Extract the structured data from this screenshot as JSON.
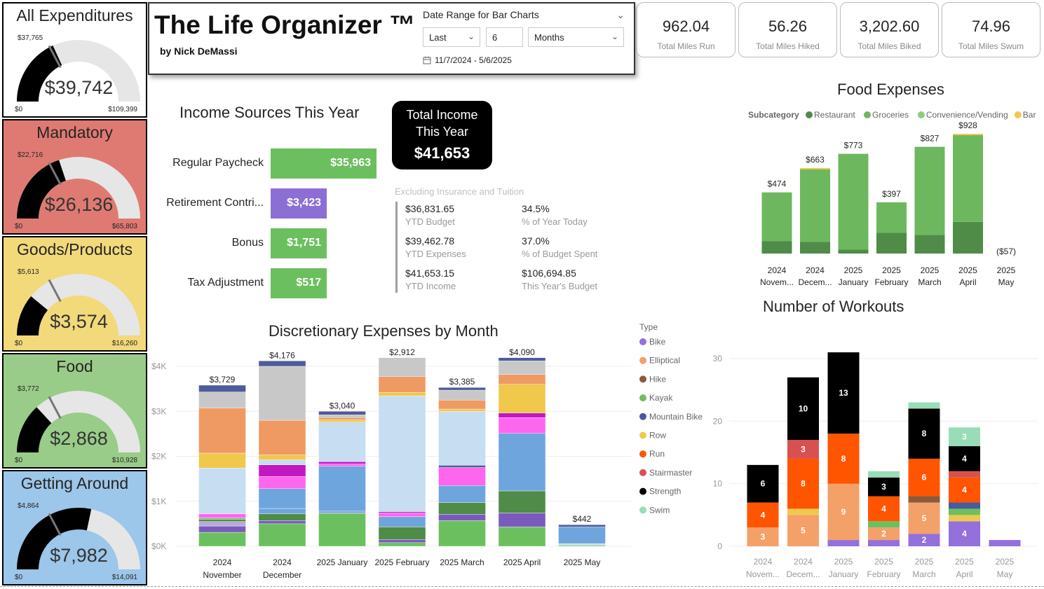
{
  "gauges": [
    {
      "title": "All Expenditures",
      "value": "$39,742",
      "target": "$37,765",
      "min": "$0",
      "max": "$109,399",
      "bg": "#ffffff",
      "value_num": 39742,
      "target_num": 37765,
      "max_num": 109399
    },
    {
      "title": "Mandatory",
      "value": "$26,136",
      "target": "$22,716",
      "min": "$0",
      "max": "$65,803",
      "bg": "#df7a73",
      "value_num": 26136,
      "target_num": 22716,
      "max_num": 65803
    },
    {
      "title": "Goods/Products",
      "value": "$3,574",
      "target": "$5,613",
      "min": "$0",
      "max": "$16,260",
      "bg": "#f2d97a",
      "value_num": 3574,
      "target_num": 5613,
      "max_num": 16260
    },
    {
      "title": "Food",
      "value": "$2,868",
      "target": "$3,772",
      "min": "$0",
      "max": "$10,928",
      "bg": "#99cc88",
      "value_num": 2868,
      "target_num": 3772,
      "max_num": 10928
    },
    {
      "title": "Getting Around",
      "value": "$7,982",
      "target": "$4,864",
      "min": "$0",
      "max": "$14,091",
      "bg": "#9cc6ea",
      "value_num": 7982,
      "target_num": 4864,
      "max_num": 14091
    }
  ],
  "header": {
    "title": "The Life Organizer ™",
    "subtitle": "by Nick DeMassi",
    "date_label": "Date Range for Bar Charts",
    "relative": "Last",
    "count": "6",
    "unit": "Months",
    "range": "11/7/2024 - 5/6/2025"
  },
  "kpis": [
    {
      "value": "962.04",
      "label": "Total Miles Run"
    },
    {
      "value": "56.26",
      "label": "Total Miles Hiked"
    },
    {
      "value": "3,202.60",
      "label": "Total Miles Biked"
    },
    {
      "value": "74.96",
      "label": "Total Miles Swum"
    }
  ],
  "income": {
    "title": "Income Sources This Year",
    "bars": [
      {
        "label": "Regular Paycheck",
        "value": "$35,963",
        "amount": 35963,
        "color": "#6cbf5e"
      },
      {
        "label": "Retirement Contri...",
        "value": "$3,423",
        "amount": 3423,
        "color": "#8c6fd4"
      },
      {
        "label": "Bonus",
        "value": "$1,751",
        "amount": 1751,
        "color": "#6cbf5e"
      },
      {
        "label": "Tax Adjustment",
        "value": "$517",
        "amount": 517,
        "color": "#6cbf5e"
      }
    ],
    "total_line1": "Total Income",
    "total_line2": "This Year",
    "total_value": "$41,653",
    "excluding": "Excluding Insurance and Tuition",
    "stats": [
      {
        "value": "$36,831.65",
        "label": "YTD Budget"
      },
      {
        "value": "34.5%",
        "label": "% of Year Today"
      },
      {
        "value": "$39,462.78",
        "label": "YTD Expenses"
      },
      {
        "value": "37.0%",
        "label": "% of Budget Spent"
      },
      {
        "value": "$41,653.15",
        "label": "YTD Income"
      },
      {
        "value": "$106,694.85",
        "label": "This Year's Budget"
      }
    ]
  },
  "chart_data": [
    {
      "type": "bar",
      "title": "Food Expenses",
      "legend_title": "Subcategory",
      "legend_position": "top",
      "categories": [
        "2024 Novem...",
        "2024 Decem...",
        "2025 January",
        "2025 February",
        "2025 March",
        "2025 April",
        "2025 May"
      ],
      "series": [
        {
          "name": "Restaurant",
          "color": "#4e8c47",
          "values": [
            95,
            90,
            30,
            160,
            145,
            245,
            0
          ]
        },
        {
          "name": "Groceries",
          "color": "#6db85e",
          "values": [
            379,
            563,
            743,
            237,
            682,
            673,
            -57
          ]
        },
        {
          "name": "Convenience/Vending",
          "color": "#8ccc7a",
          "values": [
            0,
            0,
            0,
            0,
            0,
            0,
            0
          ]
        },
        {
          "name": "Bar",
          "color": "#f0c84b",
          "values": [
            0,
            10,
            0,
            0,
            0,
            10,
            0
          ]
        }
      ],
      "totals": [
        "$474",
        "$663",
        "$773",
        "$397",
        "$827",
        "$928",
        "($57)"
      ]
    },
    {
      "type": "bar",
      "title": "Discretionary Expenses by Month",
      "categories": [
        "2024 November",
        "2024 December",
        "2025 January",
        "2025 February",
        "2025 March",
        "2025 April",
        "2025 May"
      ],
      "y_ticks": [
        "$0K",
        "$1K",
        "$2K",
        "$3K",
        "$4K"
      ],
      "ylim": [
        0,
        4200
      ],
      "totals": [
        "$3,729",
        "$4,176",
        "$3,040",
        "$2,912",
        "$3,385",
        "$4,090",
        "$442"
      ],
      "stacks": [
        [
          [
            310,
            "#6cbf5e"
          ],
          [
            140,
            "#7a5bbd"
          ],
          [
            100,
            "#b8a8dc"
          ],
          [
            50,
            "#4e8c47"
          ],
          [
            30,
            "#6cbf5e"
          ],
          [
            90,
            "#ff66ee"
          ],
          [
            1020,
            "#c6ddf2"
          ],
          [
            330,
            "#f0c84b"
          ],
          [
            1000,
            "#ef9a63"
          ],
          [
            360,
            "#c8c8c8"
          ],
          [
            150,
            "#4e5c99"
          ]
        ],
        [
          [
            500,
            "#6cbf5e"
          ],
          [
            70,
            "#7a5bbd"
          ],
          [
            150,
            "#4e8c47"
          ],
          [
            120,
            "#6fa5dd"
          ],
          [
            440,
            "#6fa5dd"
          ],
          [
            270,
            "#ff66ee"
          ],
          [
            260,
            "#c217c4"
          ],
          [
            110,
            "#c6ddf2"
          ],
          [
            110,
            "#f0c84b"
          ],
          [
            770,
            "#ef9a63"
          ],
          [
            1200,
            "#c8c8c8"
          ],
          [
            120,
            "#4e5c99"
          ]
        ],
        [
          [
            720,
            "#6cbf5e"
          ],
          [
            20,
            "#4e8c47"
          ],
          [
            40,
            "#6fa5dd"
          ],
          [
            1000,
            "#6fa5dd"
          ],
          [
            50,
            "#ff66ee"
          ],
          [
            50,
            "#c217c4"
          ],
          [
            880,
            "#c6ddf2"
          ],
          [
            50,
            "#f0c84b"
          ],
          [
            50,
            "#ef9a63"
          ],
          [
            60,
            "#c8c8c8"
          ],
          [
            80,
            "#4e5c99"
          ]
        ],
        [
          [
            80,
            "#6cbf5e"
          ],
          [
            70,
            "#7a5bbd"
          ],
          [
            280,
            "#4e8c47"
          ],
          [
            230,
            "#6fa5dd"
          ],
          [
            80,
            "#ff66ee"
          ],
          [
            30,
            "#c217c4"
          ],
          [
            2570,
            "#c6ddf2"
          ],
          [
            80,
            "#f0c84b"
          ],
          [
            350,
            "#ef9a63"
          ],
          [
            420,
            "#c8c8c8"
          ]
        ],
        [
          [
            570,
            "#6cbf5e"
          ],
          [
            140,
            "#7a5bbd"
          ],
          [
            260,
            "#4e8c47"
          ],
          [
            380,
            "#6fa5dd"
          ],
          [
            400,
            "#ff66ee"
          ],
          [
            50,
            "#4e5c99"
          ],
          [
            1200,
            "#c6ddf2"
          ],
          [
            50,
            "#f0c84b"
          ],
          [
            200,
            "#ef9a63"
          ],
          [
            220,
            "#c8c8c8"
          ],
          [
            60,
            "#4e5c99"
          ]
        ],
        [
          [
            430,
            "#6cbf5e"
          ],
          [
            310,
            "#7a5bbd"
          ],
          [
            490,
            "#4e8c47"
          ],
          [
            1280,
            "#6fa5dd"
          ],
          [
            350,
            "#ff66ee"
          ],
          [
            100,
            "#c217c4"
          ],
          [
            640,
            "#f0c84b"
          ],
          [
            220,
            "#ef9a63"
          ],
          [
            300,
            "#c8c8c8"
          ],
          [
            70,
            "#4e5c99"
          ]
        ],
        [
          [
            30,
            "#8ccc7a"
          ],
          [
            30,
            "#c6ddf2"
          ],
          [
            370,
            "#6fa5dd"
          ],
          [
            50,
            "#4e5c99"
          ]
        ]
      ]
    },
    {
      "type": "bar",
      "title": "Number of Workouts",
      "legend_title": "Type",
      "legend_position": "left",
      "categories": [
        "2024 Novem...",
        "2024 Decem...",
        "2025 January",
        "2025 February",
        "2025 March",
        "2025 April",
        "2025 May"
      ],
      "y_ticks": [
        0,
        10,
        20,
        30
      ],
      "ylim": [
        0,
        32
      ],
      "legend": [
        {
          "name": "Bike",
          "color": "#9370db"
        },
        {
          "name": "Elliptical",
          "color": "#f4a069"
        },
        {
          "name": "Hike",
          "color": "#8b5a3c"
        },
        {
          "name": "Kayak",
          "color": "#6cbf5e"
        },
        {
          "name": "Mountain Bike",
          "color": "#4a5a9c"
        },
        {
          "name": "Row",
          "color": "#f0c84b"
        },
        {
          "name": "Run",
          "color": "#ff5500"
        },
        {
          "name": "Stairmaster",
          "color": "#d95050"
        },
        {
          "name": "Strength",
          "color": "#000000"
        },
        {
          "name": "Swim",
          "color": "#99ddb8"
        }
      ],
      "stacks": [
        [
          [
            3,
            "#f4a069",
            "3"
          ],
          [
            4,
            "#ff5500",
            "4"
          ],
          [
            6,
            "#000000",
            "6"
          ]
        ],
        [
          [
            5,
            "#f4a069",
            "5"
          ],
          [
            1,
            "#f0c84b",
            ""
          ],
          [
            8,
            "#ff5500",
            "8"
          ],
          [
            3,
            "#d95050",
            "3"
          ],
          [
            10,
            "#000000",
            "10"
          ]
        ],
        [
          [
            1,
            "#9370db",
            ""
          ],
          [
            9,
            "#f4a069",
            "9"
          ],
          [
            8,
            "#ff5500",
            "8"
          ],
          [
            13,
            "#000000",
            "13"
          ]
        ],
        [
          [
            1,
            "#9370db",
            ""
          ],
          [
            2,
            "#f4a069",
            "2"
          ],
          [
            1,
            "#6cbf5e",
            ""
          ],
          [
            4,
            "#ff5500",
            "4"
          ],
          [
            3,
            "#000000",
            "3"
          ],
          [
            1,
            "#99ddb8",
            ""
          ]
        ],
        [
          [
            2,
            "#9370db",
            "2"
          ],
          [
            5,
            "#f4a069",
            "5"
          ],
          [
            1,
            "#8b5a3c",
            ""
          ],
          [
            6,
            "#ff5500",
            "6"
          ],
          [
            8,
            "#000000",
            "8"
          ],
          [
            1,
            "#99ddb8",
            ""
          ]
        ],
        [
          [
            4,
            "#9370db",
            "4"
          ],
          [
            1,
            "#f0c84b",
            ""
          ],
          [
            1,
            "#6cbf5e",
            ""
          ],
          [
            1,
            "#4a5a9c",
            ""
          ],
          [
            4,
            "#ff5500",
            "4"
          ],
          [
            1,
            "#d95050",
            ""
          ],
          [
            4,
            "#000000",
            "4"
          ],
          [
            3,
            "#99ddb8",
            "3"
          ]
        ],
        [
          [
            1,
            "#9370db",
            ""
          ]
        ]
      ]
    }
  ]
}
